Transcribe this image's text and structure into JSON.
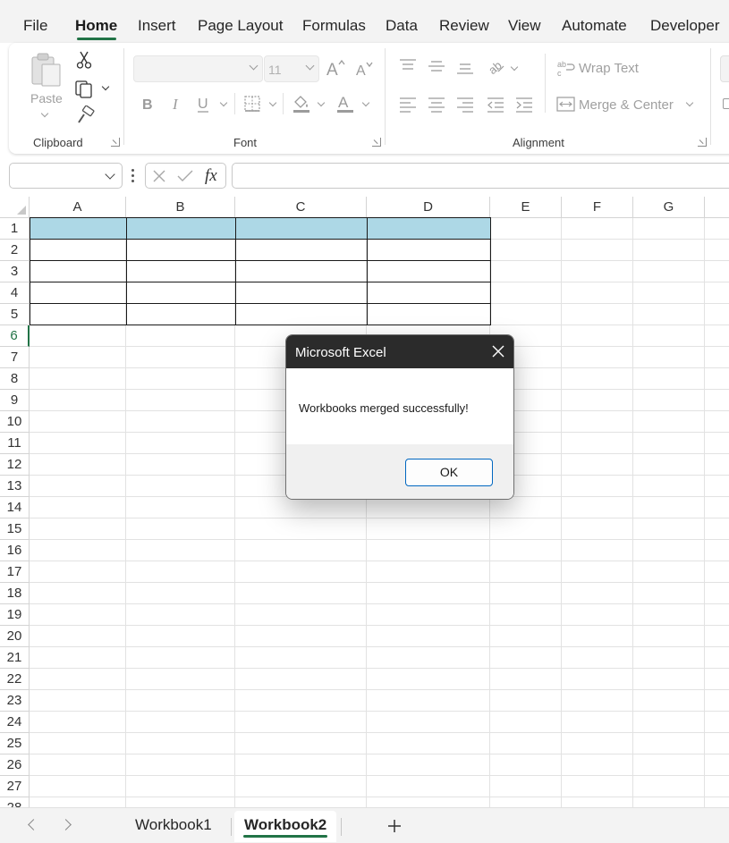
{
  "ribbon_tabs": [
    "File",
    "Home",
    "Insert",
    "Page Layout",
    "Formulas",
    "Data",
    "Review",
    "View",
    "Automate",
    "Developer"
  ],
  "active_tab": "Home",
  "clipboard": {
    "paste_label": "Paste",
    "group_label": "Clipboard"
  },
  "font": {
    "font_name": "",
    "font_size": "11",
    "group_label": "Font"
  },
  "alignment": {
    "wrap_text_label": "Wrap Text",
    "merge_center_label": "Merge & Center",
    "group_label": "Alignment"
  },
  "formula_bar": {
    "name_box_value": "",
    "formula_value": "",
    "fx_label": "fx"
  },
  "grid": {
    "columns": [
      "A",
      "B",
      "C",
      "D",
      "E",
      "F",
      "G"
    ],
    "rows": [
      "1",
      "2",
      "3",
      "4",
      "5",
      "6",
      "7",
      "8",
      "9",
      "10",
      "11",
      "12",
      "13",
      "14",
      "15",
      "16",
      "17",
      "18",
      "19",
      "20",
      "21",
      "22",
      "23",
      "24",
      "25",
      "26",
      "27",
      "28"
    ],
    "active_row": "6"
  },
  "dialog": {
    "title": "Microsoft Excel",
    "message": "Workbooks merged successfully!",
    "ok_label": "OK"
  },
  "sheets": {
    "tabs": [
      "Workbook1",
      "Workbook2"
    ],
    "active": "Workbook2"
  },
  "colors": {
    "accent": "#217346",
    "table_header_fill": "#add8e6"
  }
}
